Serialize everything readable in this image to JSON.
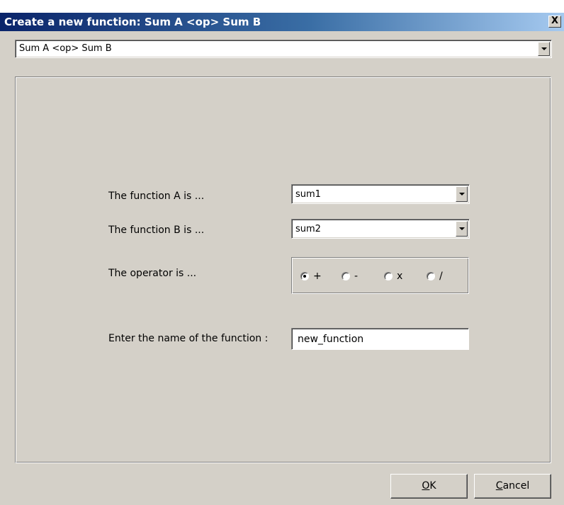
{
  "window": {
    "title": "Create a new function: Sum A <op> Sum B",
    "close_glyph": "X"
  },
  "template_select": {
    "value": "Sum A <op> Sum B"
  },
  "form": {
    "function_a_label": "The function A is ...",
    "function_a_value": "sum1",
    "function_b_label": "The function B is ...",
    "function_b_value": "sum2",
    "operator_label": "The operator is ...",
    "operators": [
      {
        "label": "+",
        "checked": true
      },
      {
        "label": "-",
        "checked": false
      },
      {
        "label": "x",
        "checked": false
      },
      {
        "label": "/",
        "checked": false
      }
    ],
    "name_label": "Enter the name of the function :",
    "name_value": "new_function"
  },
  "buttons": {
    "ok_mnemonic": "O",
    "ok_rest": "K",
    "cancel_mnemonic": "C",
    "cancel_rest": "ancel"
  },
  "colors": {
    "face": "#d4d0c8",
    "title_start": "#0a246a",
    "title_end": "#a6caf0"
  }
}
